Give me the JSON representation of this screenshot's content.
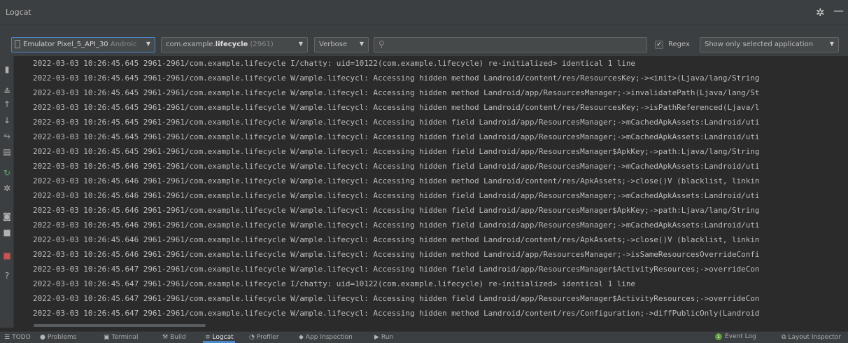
{
  "window": {
    "title": "Logcat",
    "gear_icon": "gear-icon",
    "minimize_icon": "minimize-icon"
  },
  "toolbar": {
    "device_main": "Emulator Pixel_5_API_30",
    "device_suffix": " Androic",
    "package_prefix": "com.example.",
    "package_bold": "lifecycle",
    "package_pid": " (2961)",
    "log_level": "Verbose",
    "search_value": "",
    "regex_label": "Regex",
    "regex_checked": true,
    "filter": "Show only selected application"
  },
  "sidebar": {
    "icons": [
      "trash-icon",
      "soft-wrap-icon",
      "up-arrow-icon",
      "down-arrow-icon",
      "wrap-lines-icon",
      "print-icon",
      "restart-icon",
      "settings-icon",
      "screenshot-icon",
      "screen-record-icon",
      "stop-icon",
      "help-icon"
    ]
  },
  "log": {
    "lines": [
      "2022-03-03 10:26:45.645 2961-2961/com.example.lifecycle I/chatty: uid=10122(com.example.lifecycle) re-initialized> identical 1 line",
      "2022-03-03 10:26:45.645 2961-2961/com.example.lifecycle W/ample.lifecycl: Accessing hidden method Landroid/content/res/ResourcesKey;-><init>(Ljava/lang/String",
      "2022-03-03 10:26:45.645 2961-2961/com.example.lifecycle W/ample.lifecycl: Accessing hidden method Landroid/app/ResourcesManager;->invalidatePath(Ljava/lang/St",
      "2022-03-03 10:26:45.645 2961-2961/com.example.lifecycle W/ample.lifecycl: Accessing hidden method Landroid/content/res/ResourcesKey;->isPathReferenced(Ljava/l",
      "2022-03-03 10:26:45.645 2961-2961/com.example.lifecycle W/ample.lifecycl: Accessing hidden field Landroid/app/ResourcesManager;->mCachedApkAssets:Landroid/uti",
      "2022-03-03 10:26:45.645 2961-2961/com.example.lifecycle W/ample.lifecycl: Accessing hidden field Landroid/app/ResourcesManager;->mCachedApkAssets:Landroid/uti",
      "2022-03-03 10:26:45.645 2961-2961/com.example.lifecycle W/ample.lifecycl: Accessing hidden field Landroid/app/ResourcesManager$ApkKey;->path:Ljava/lang/String",
      "2022-03-03 10:26:45.646 2961-2961/com.example.lifecycle W/ample.lifecycl: Accessing hidden field Landroid/app/ResourcesManager;->mCachedApkAssets:Landroid/uti",
      "2022-03-03 10:26:45.646 2961-2961/com.example.lifecycle W/ample.lifecycl: Accessing hidden method Landroid/content/res/ApkAssets;->close()V (blacklist, linkin",
      "2022-03-03 10:26:45.646 2961-2961/com.example.lifecycle W/ample.lifecycl: Accessing hidden field Landroid/app/ResourcesManager;->mCachedApkAssets:Landroid/uti",
      "2022-03-03 10:26:45.646 2961-2961/com.example.lifecycle W/ample.lifecycl: Accessing hidden field Landroid/app/ResourcesManager$ApkKey;->path:Ljava/lang/String",
      "2022-03-03 10:26:45.646 2961-2961/com.example.lifecycle W/ample.lifecycl: Accessing hidden field Landroid/app/ResourcesManager;->mCachedApkAssets:Landroid/uti",
      "2022-03-03 10:26:45.646 2961-2961/com.example.lifecycle W/ample.lifecycl: Accessing hidden method Landroid/content/res/ApkAssets;->close()V (blacklist, linkin",
      "2022-03-03 10:26:45.646 2961-2961/com.example.lifecycle W/ample.lifecycl: Accessing hidden method Landroid/app/ResourcesManager;->isSameResourcesOverrideConfi",
      "2022-03-03 10:26:45.647 2961-2961/com.example.lifecycle W/ample.lifecycl: Accessing hidden field Landroid/app/ResourcesManager$ActivityResources;->overrideCon",
      "2022-03-03 10:26:45.647 2961-2961/com.example.lifecycle I/chatty: uid=10122(com.example.lifecycle) re-initialized> identical 1 line",
      "2022-03-03 10:26:45.647 2961-2961/com.example.lifecycle W/ample.lifecycl: Accessing hidden field Landroid/app/ResourcesManager$ActivityResources;->overrideCon",
      "2022-03-03 10:26:45.647 2961-2961/com.example.lifecycle W/ample.lifecycl: Accessing hidden method Landroid/content/res/Configuration;->diffPublicOnly(Landroid"
    ]
  },
  "statusbar": {
    "todo": "TODO",
    "problems": "Problems",
    "terminal": "Terminal",
    "build": "Build",
    "logcat": "Logcat",
    "profiler": "Profiler",
    "app_inspection": "App Inspection",
    "run": "Run",
    "event_log_count": "1",
    "event_log": "Event Log",
    "layout_inspector": "Layout Inspector"
  },
  "colors": {
    "background": "#2b2b2b",
    "panel": "#3c3f41",
    "accent": "#4a88c7",
    "text": "#bbbbbb"
  }
}
